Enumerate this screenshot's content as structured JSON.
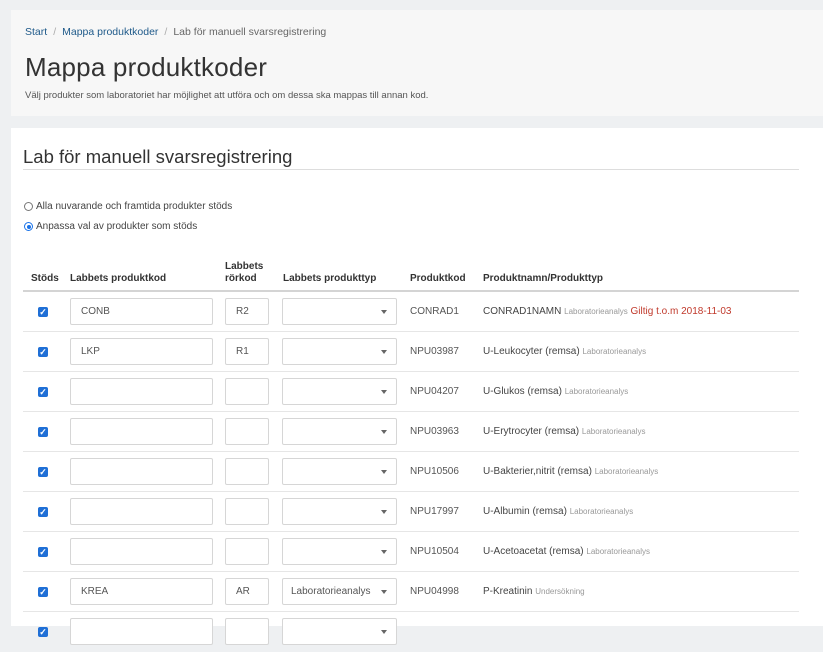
{
  "breadcrumb": {
    "start": "Start",
    "separator": "/",
    "map": "Mappa produktkoder",
    "current": "Lab för manuell svarsregistrering"
  },
  "page": {
    "title": "Mappa produktkoder",
    "description": "Välj produkter som laboratoriet har möjlighet att utföra och om dessa ska mappas till annan kod."
  },
  "section": {
    "title": "Lab för manuell svarsregistrering"
  },
  "radio_options": [
    {
      "label": "Alla nuvarande och framtida produkter stöds",
      "checked": false
    },
    {
      "label": "Anpassa val av produkter som stöds",
      "checked": true
    }
  ],
  "table": {
    "headers": {
      "supported": "Stöds",
      "lab_code": "Labbets produktkod",
      "tube_code_line1": "Labbets",
      "tube_code_line2": "rörkod",
      "lab_type": "Labbets produkttyp",
      "product_code": "Produktkod",
      "product_name": "Produktnamn/Produkttyp"
    },
    "checkbox_mark": "✓",
    "rows": [
      {
        "supported": true,
        "lab_code": "CONB",
        "tube_code": "R2",
        "lab_type": "",
        "product_code": "CONRAD1",
        "name": "CONRAD1NAMN",
        "type": "Laboratorieanalys",
        "validity": "Giltig t.o.m 2018-11-03"
      },
      {
        "supported": true,
        "lab_code": "LKP",
        "tube_code": "R1",
        "lab_type": "",
        "product_code": "NPU03987",
        "name": "U-Leukocyter (remsa)",
        "type": "Laboratorieanalys",
        "validity": ""
      },
      {
        "supported": true,
        "lab_code": "",
        "tube_code": "",
        "lab_type": "",
        "product_code": "NPU04207",
        "name": "U-Glukos (remsa)",
        "type": "Laboratorieanalys",
        "validity": ""
      },
      {
        "supported": true,
        "lab_code": "",
        "tube_code": "",
        "lab_type": "",
        "product_code": "NPU03963",
        "name": "U-Erytrocyter (remsa)",
        "type": "Laboratorieanalys",
        "validity": ""
      },
      {
        "supported": true,
        "lab_code": "",
        "tube_code": "",
        "lab_type": "",
        "product_code": "NPU10506",
        "name": "U-Bakterier,nitrit (remsa)",
        "type": "Laboratorieanalys",
        "validity": ""
      },
      {
        "supported": true,
        "lab_code": "",
        "tube_code": "",
        "lab_type": "",
        "product_code": "NPU17997",
        "name": "U-Albumin (remsa)",
        "type": "Laboratorieanalys",
        "validity": ""
      },
      {
        "supported": true,
        "lab_code": "",
        "tube_code": "",
        "lab_type": "",
        "product_code": "NPU10504",
        "name": "U-Acetoacetat (remsa)",
        "type": "Laboratorieanalys",
        "validity": ""
      },
      {
        "supported": true,
        "lab_code": "KREA",
        "tube_code": "AR",
        "lab_type": "Laboratorieanalys",
        "product_code": "NPU04998",
        "name": "P-Kreatinin",
        "type": "Undersökning",
        "validity": ""
      },
      {
        "supported": true,
        "lab_code": "",
        "tube_code": "",
        "lab_type": "",
        "product_code": "",
        "name": "",
        "type": "",
        "validity": ""
      }
    ]
  },
  "colors": {
    "accent": "#1f6fd6",
    "link": "#1f5a8a",
    "validity": "#c0392b",
    "background": "#eef0f2"
  }
}
